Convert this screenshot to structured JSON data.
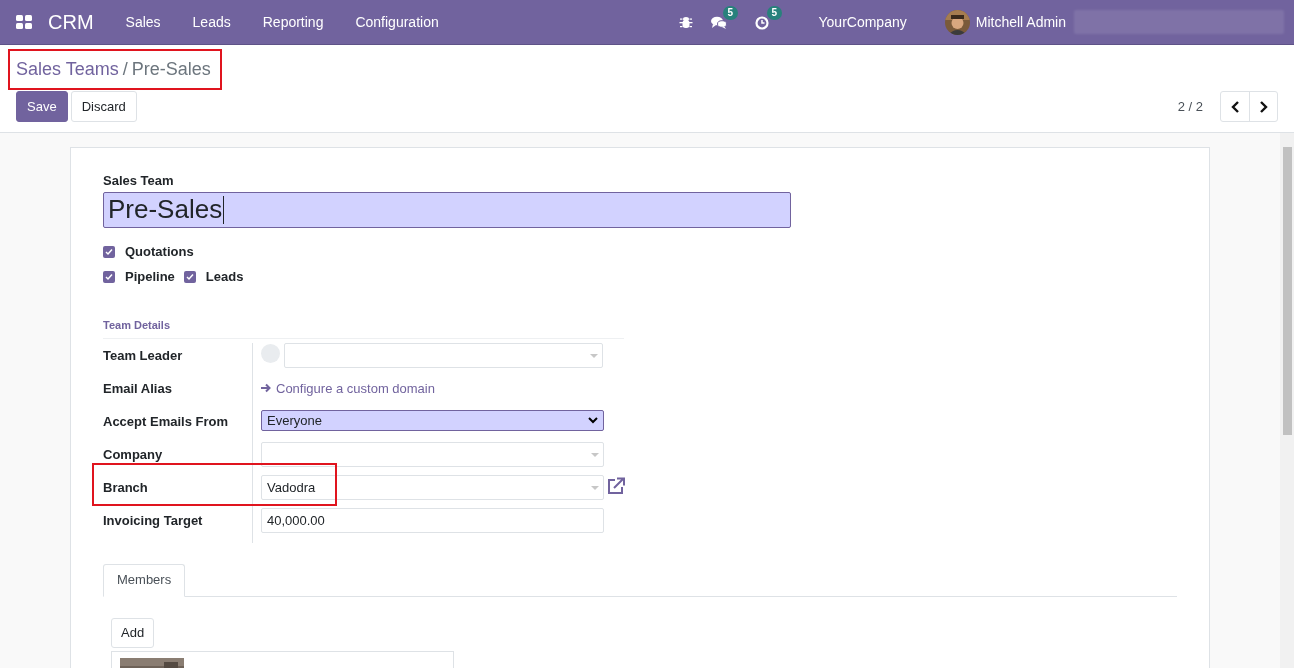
{
  "navbar": {
    "app_title": "CRM",
    "menu": [
      {
        "label": "Sales"
      },
      {
        "label": "Leads"
      },
      {
        "label": "Reporting"
      },
      {
        "label": "Configuration"
      }
    ],
    "messages_count": "5",
    "activities_count": "5",
    "company": "YourCompany",
    "user": "Mitchell Admin"
  },
  "breadcrumb": [
    {
      "label": "Sales Teams",
      "separator": "/"
    },
    {
      "label": "Pre-Sales"
    }
  ],
  "actions": [
    {
      "label": "Save",
      "primary": true
    },
    {
      "label": "Discard",
      "primary": false
    }
  ],
  "pager": {
    "text": "2 / 2"
  },
  "form": {
    "name_label": "Sales Team",
    "name_value": "Pre-Sales",
    "options": [
      [
        {
          "label": "Quotations",
          "checked": true
        }
      ],
      [
        {
          "label": "Pipeline",
          "checked": true
        },
        {
          "label": "Leads",
          "checked": true
        }
      ]
    ],
    "section_title": "Team Details",
    "fields": [
      {
        "label": "Team Leader",
        "kind": "many2one_avatar"
      },
      {
        "label": "Email Alias",
        "kind": "link",
        "value": "Configure a custom domain"
      },
      {
        "label": "Accept Emails From",
        "kind": "select",
        "value": "Everyone"
      },
      {
        "label": "Company",
        "kind": "many2one"
      },
      {
        "label": "Branch",
        "kind": "many2one_link",
        "value": "Vadodra",
        "highlighted": true
      },
      {
        "label": "Invoicing Target",
        "kind": "text",
        "value": "40,000.00"
      }
    ],
    "tabs": [
      {
        "label": "Members",
        "selected": true
      }
    ],
    "add_button": "Add"
  }
}
